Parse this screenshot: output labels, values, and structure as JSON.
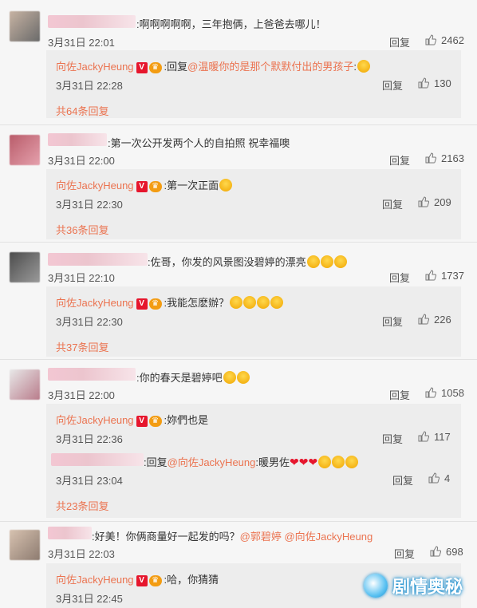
{
  "actions": {
    "reply": "回复"
  },
  "reply_author": "向佐JackyHeung",
  "badge_v": "V",
  "watermark": "剧情奥秘",
  "comments": [
    {
      "text": ":啊啊啊啊啊，三年抱俩，上爸爸去哪儿！",
      "time": "3月31日 22:01",
      "likes": "2462",
      "replies": [
        {
          "prefix": ":回复",
          "mention": "@温暖你的是那个默默付出的男孩子",
          "suffix": ":",
          "time": "3月31日 22:28",
          "likes": "130"
        }
      ],
      "more": "共64条回复"
    },
    {
      "text": ":第一次公开发两个人的自拍照 祝幸福噢",
      "time": "3月31日 22:00",
      "likes": "2163",
      "replies": [
        {
          "prefix": ":第一次正面",
          "mention": "",
          "suffix": "",
          "time": "3月31日 22:30",
          "likes": "209"
        }
      ],
      "more": "共36条回复"
    },
    {
      "text": ":佐哥，你发的风景图没碧婷的漂亮",
      "time": "3月31日 22:10",
      "likes": "1737",
      "replies": [
        {
          "prefix": ":我能怎麽辦？",
          "mention": "",
          "suffix": "",
          "time": "3月31日 22:30",
          "likes": "226"
        }
      ],
      "more": "共37条回复"
    },
    {
      "text": ":你的春天是碧婷吧",
      "time": "3月31日 22:00",
      "likes": "1058",
      "replies": [
        {
          "prefix": ":妳們也是",
          "mention": "",
          "suffix": "",
          "time": "3月31日 22:36",
          "likes": "117"
        },
        {
          "prefix": ":回复",
          "mention": "@向佐JackyHeung",
          "suffix": ":暖男佐",
          "time": "3月31日 23:04",
          "likes": "4"
        }
      ],
      "more": "共23条回复"
    },
    {
      "text": ":好美！你俩商量好一起发的吗？",
      "mention1": "@郭碧婷",
      "mention2": "@向佐JackyHeung",
      "time": "3月31日 22:03",
      "likes": "698",
      "replies": [
        {
          "prefix": ":哈，你猜猜",
          "mention": "",
          "suffix": "",
          "time": "3月31日 22:45",
          "likes": ""
        }
      ]
    }
  ]
}
